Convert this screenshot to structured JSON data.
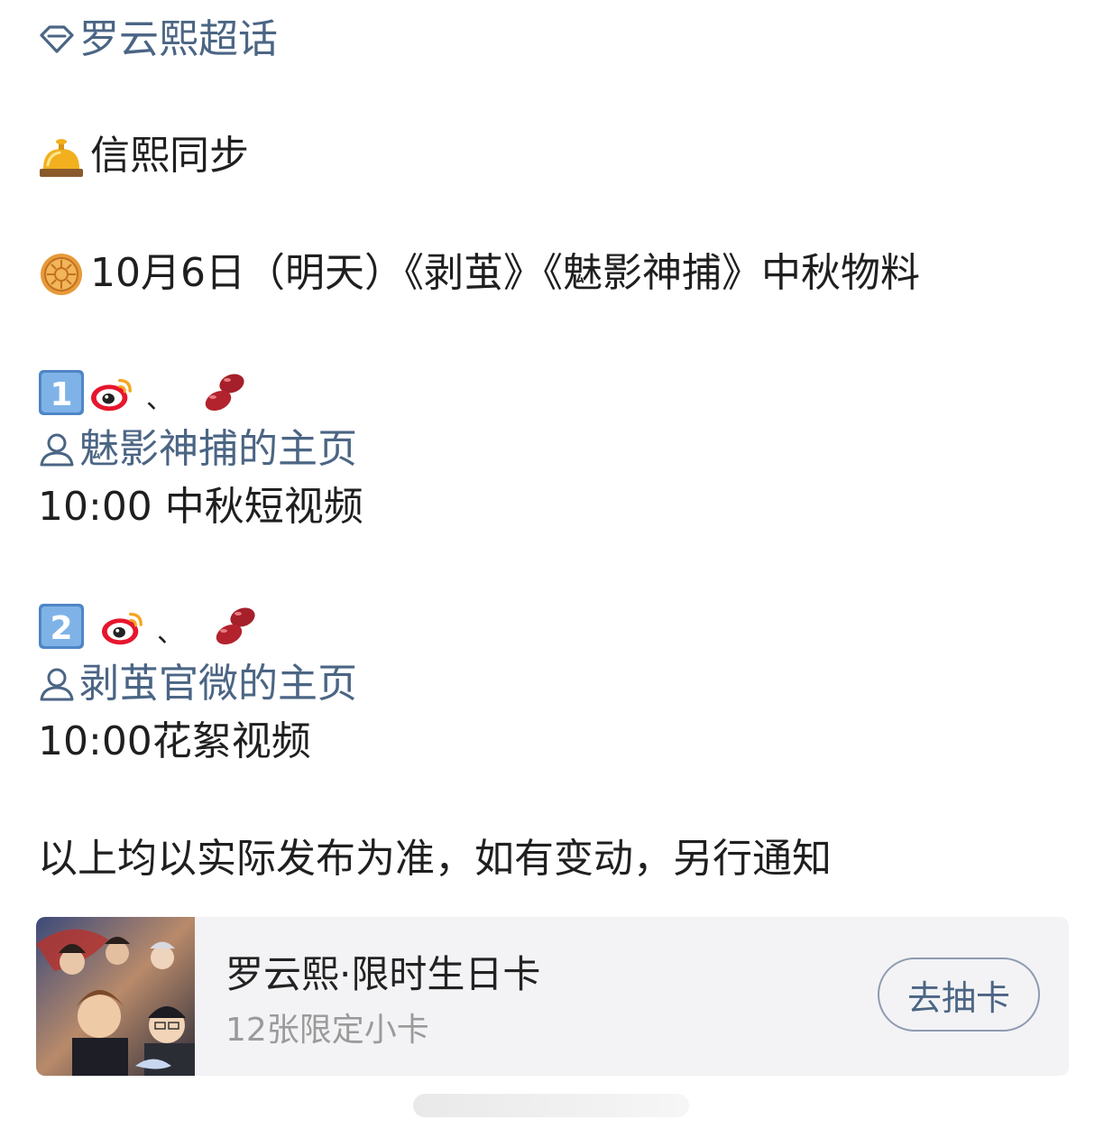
{
  "post": {
    "topic_label": "罗云熙超话",
    "header_line": "信熙同步",
    "date_line": "10月6日（明天）《剥茧》《魅影神捕》中秋物料",
    "item1": {
      "number_icon": "keycap-1",
      "platform_icons": [
        "weibo-icon",
        "bean-icon"
      ],
      "separator": "、",
      "profile_link": "魅影神捕的主页",
      "detail": "10:00 中秋短视频"
    },
    "item2": {
      "number_icon": "keycap-2",
      "platform_icons": [
        "weibo-icon",
        "bean-icon"
      ],
      "separator": "、",
      "profile_link": "剥茧官微的主页",
      "detail": "10:00花絮视频"
    },
    "footer_note": "以上均以实际发布为准，如有变动，另行通知"
  },
  "card": {
    "title": "罗云熙·限时生日卡",
    "subtitle": "12张限定小卡",
    "button_label": "去抽卡"
  },
  "colors": {
    "link": "#4b6584",
    "card_bg": "#f3f3f5",
    "text": "#1f1f1f",
    "muted": "#9a9a9a"
  }
}
